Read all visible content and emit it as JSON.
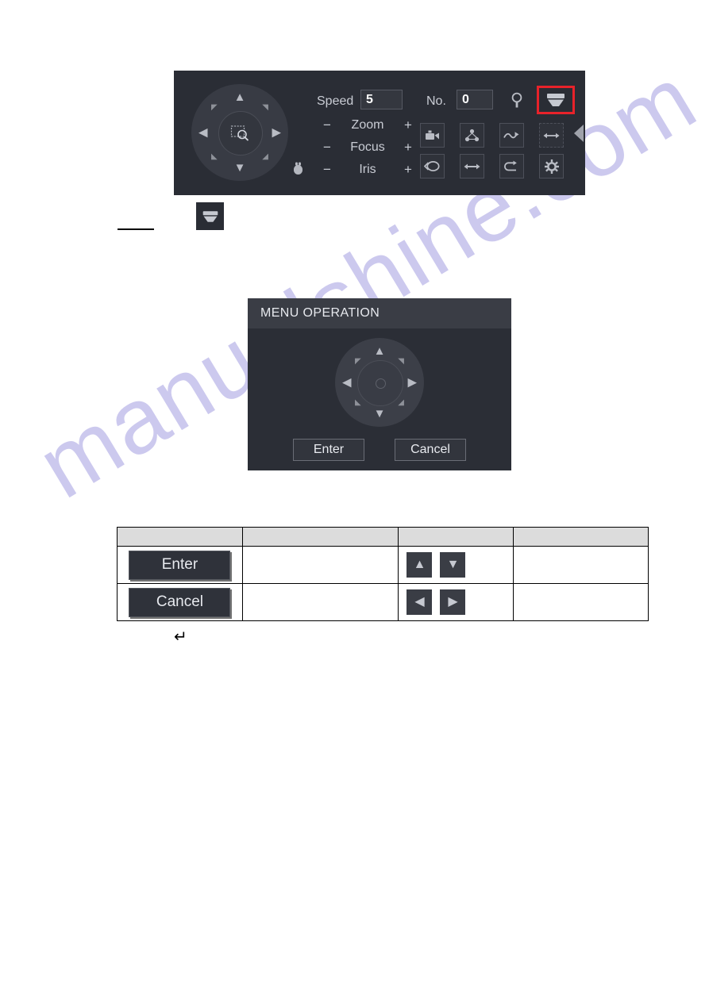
{
  "watermark": {
    "text": "manualshine.com"
  },
  "ptz_panel": {
    "name": "ptz-control-panel",
    "speed": {
      "label": "Speed",
      "value": "5"
    },
    "preset_no": {
      "label": "No.",
      "value": "0"
    },
    "steppers": [
      {
        "name": "zoom",
        "minus": "−",
        "label": "Zoom",
        "plus": "+"
      },
      {
        "name": "focus",
        "minus": "−",
        "label": "Focus",
        "plus": "+"
      },
      {
        "name": "iris",
        "minus": "−",
        "label": "Iris",
        "plus": "+"
      }
    ],
    "joystick": {
      "up": "▲",
      "down": "▼",
      "left": "◀",
      "right": "▶",
      "up_left": "◤",
      "up_right": "◥",
      "down_left": "◣",
      "down_right": "◢",
      "center_icon": "zoom-region-icon"
    },
    "icons": {
      "mouse": "mouse-icon",
      "light": "light-bulb-icon",
      "menu_dome": "dome-camera-menu-icon",
      "highlight_color": "#e8222a"
    },
    "icon_grid": [
      {
        "name": "preset-icon"
      },
      {
        "name": "tour-icon"
      },
      {
        "name": "pattern-icon"
      },
      {
        "name": "auto-scan-icon"
      },
      {
        "name": "rotate-icon"
      },
      {
        "name": "pan-icon"
      },
      {
        "name": "flip-icon"
      },
      {
        "name": "settings-gear-icon"
      }
    ],
    "collapse": "collapse-left-arrow-icon"
  },
  "standalone_icon": {
    "name": "dome-camera-menu-icon"
  },
  "dialog": {
    "title": "MENU OPERATION",
    "buttons": [
      {
        "name": "enter-button",
        "label": "Enter"
      },
      {
        "name": "cancel-button",
        "label": "Cancel"
      }
    ],
    "joystick": {
      "up": "▲",
      "down": "▼",
      "left": "◀",
      "right": "▶",
      "up_left": "◤",
      "up_right": "◥",
      "down_left": "◣",
      "down_right": "◢"
    }
  },
  "table": {
    "headers": [
      "",
      "",
      "",
      ""
    ],
    "rows": [
      {
        "button_label": "Enter",
        "col2": "",
        "arrows": [
          "▲",
          "▼"
        ],
        "col4": ""
      },
      {
        "button_label": "Cancel",
        "col2": "",
        "arrows": [
          "◀",
          "▶"
        ],
        "col4": ""
      }
    ]
  },
  "footnote": {
    "return_glyph": "↵"
  }
}
